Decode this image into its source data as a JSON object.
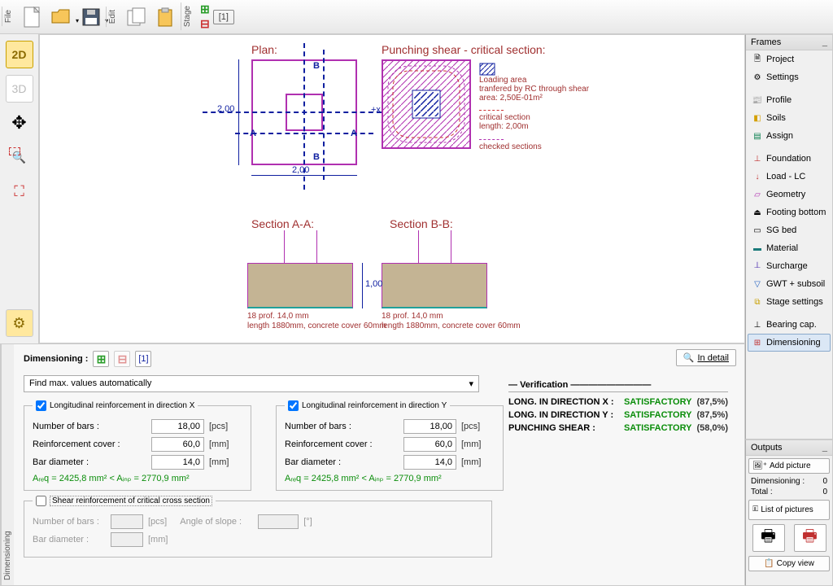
{
  "toolbar": {
    "file_tab": "File",
    "edit_tab": "Edit",
    "stage_tab": "Stage",
    "stage_num": "[1]"
  },
  "left": {
    "b2d": "2D",
    "b3d": "3D"
  },
  "drawing": {
    "plan_title": "Plan:",
    "dim_h": "2,00",
    "dim_w": "2,00",
    "axis_x": "+x",
    "mark_a1": "A",
    "mark_a2": "A",
    "mark_b1": "B",
    "mark_b2": "B",
    "punching_title": "Punching shear - critical section:",
    "loading_area": "Loading area",
    "loading_sub": "tranfered by RC through shear",
    "loading_area_val": "area: 2,50E-01m²",
    "crit_sec": "critical section",
    "crit_len": "length: 2,00m",
    "checked": "checked sections",
    "sec_a_title": "Section A-A:",
    "sec_b_title": "Section B-B:",
    "sec_depth": "1,00",
    "sec_a_line1": "18 prof. 14,0 mm",
    "sec_a_line2": "length 1880mm, concrete cover 60mm",
    "sec_b_line1": "18 prof. 14,0 mm",
    "sec_b_line2": "length 1880mm, concrete cover 60mm"
  },
  "frames_panel": {
    "title": "Frames",
    "items": [
      "Project",
      "Settings",
      "Profile",
      "Soils",
      "Assign",
      "Foundation",
      "Load - LC",
      "Geometry",
      "Footing bottom",
      "SG bed",
      "Material",
      "Surcharge",
      "GWT + subsoil",
      "Stage settings",
      "Bearing cap.",
      "Dimensioning"
    ]
  },
  "lower": {
    "tab": "Dimensioning",
    "header": "Dimensioning :",
    "stage_num": "[1]",
    "in_detail": "In detail",
    "combo": "Find max. values automatically",
    "longx_legend": "Longitudinal reinforcement in direction X",
    "longy_legend": "Longitudinal reinforcement in direction Y",
    "num_bars_label": "Number of bars :",
    "cover_label": "Reinforcement cover :",
    "diam_label": "Bar diameter :",
    "num_bars_x": "18,00",
    "num_bars_y": "18,00",
    "cover_x": "60,0",
    "cover_y": "60,0",
    "diam_x": "14,0",
    "diam_y": "14,0",
    "unit_pcs": "[pcs]",
    "unit_mm": "[mm]",
    "unit_deg": "[°]",
    "formula_x": "Aᵣₑq = 2425,8 mm² < Aᵢₙₚ = 2770,9 mm²",
    "formula_y": "Aᵣₑq = 2425,8 mm² < Aᵢₙₚ = 2770,9 mm²",
    "shear_legend": "Shear reinforcement of critical cross section",
    "angle_label": "Angle of slope :"
  },
  "verification": {
    "title": "Verification",
    "rows": [
      {
        "k": "LONG. IN DIRECTION X :",
        "v": "SATISFACTORY",
        "p": "(87,5%)"
      },
      {
        "k": "LONG. IN DIRECTION Y :",
        "v": "SATISFACTORY",
        "p": "(87,5%)"
      },
      {
        "k": "PUNCHING SHEAR :",
        "v": "SATISFACTORY",
        "p": "(58,0%)"
      }
    ]
  },
  "outputs": {
    "title": "Outputs",
    "add_pic": "Add picture",
    "dim_label": "Dimensioning :",
    "dim_val": "0",
    "total_label": "Total :",
    "total_val": "0",
    "list_pic": "List of pictures",
    "copy_view": "Copy view"
  }
}
